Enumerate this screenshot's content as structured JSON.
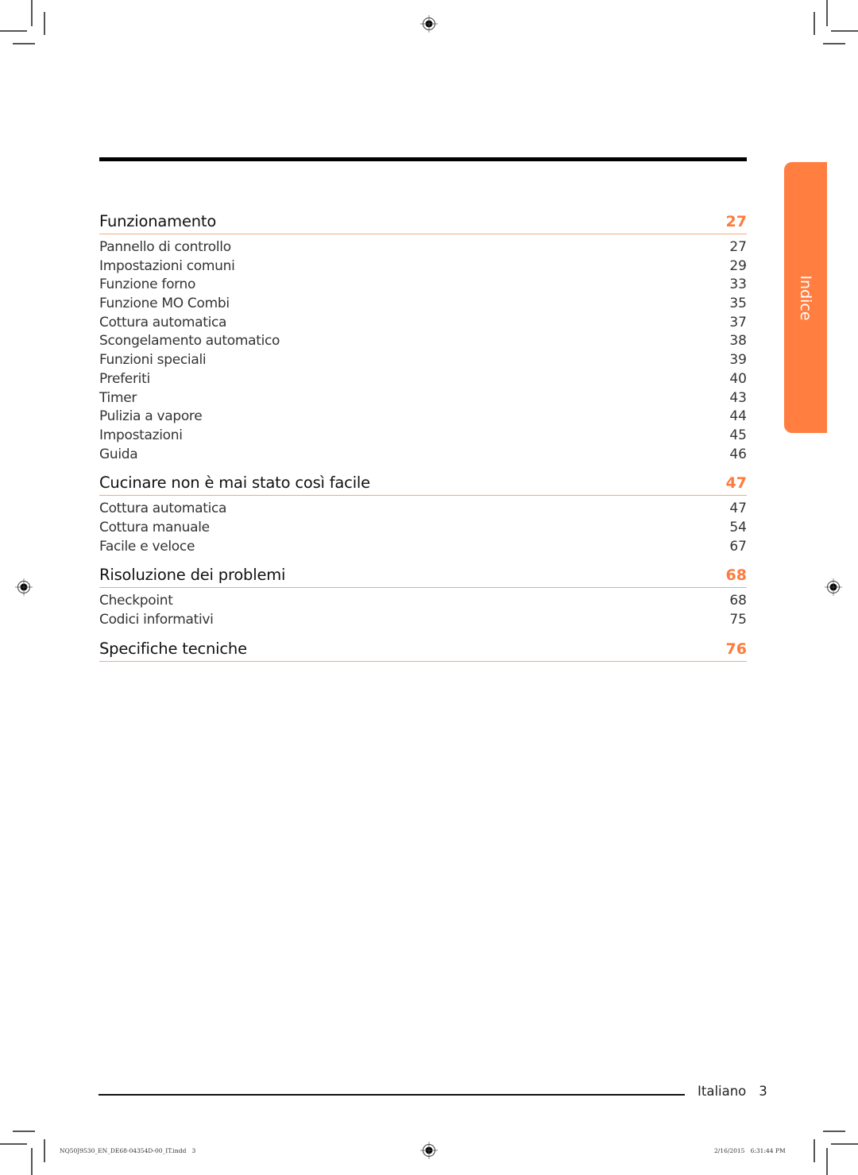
{
  "side_tab": {
    "label": "Indice",
    "color": "#ff7e40"
  },
  "accent_color": "#ff7a3d",
  "toc": [
    {
      "title": "Funzionamento",
      "page": "27",
      "items": [
        {
          "label": "Pannello di controllo",
          "page": "27"
        },
        {
          "label": "Impostazioni comuni",
          "page": "29"
        },
        {
          "label": "Funzione forno",
          "page": "33"
        },
        {
          "label": "Funzione MO Combi",
          "page": "35"
        },
        {
          "label": "Cottura automatica",
          "page": "37"
        },
        {
          "label": "Scongelamento automatico",
          "page": "38"
        },
        {
          "label": "Funzioni speciali",
          "page": "39"
        },
        {
          "label": "Preferiti",
          "page": "40"
        },
        {
          "label": "Timer",
          "page": "43"
        },
        {
          "label": "Pulizia a vapore",
          "page": "44"
        },
        {
          "label": "Impostazioni",
          "page": "45"
        },
        {
          "label": "Guida",
          "page": "46"
        }
      ]
    },
    {
      "title": "Cucinare non è mai stato così facile",
      "page": "47",
      "items": [
        {
          "label": "Cottura automatica",
          "page": "47"
        },
        {
          "label": "Cottura manuale",
          "page": "54"
        },
        {
          "label": "Facile e veloce",
          "page": "67"
        }
      ]
    },
    {
      "title": "Risoluzione dei problemi",
      "page": "68",
      "items": [
        {
          "label": "Checkpoint",
          "page": "68"
        },
        {
          "label": "Codici informativi",
          "page": "75"
        }
      ]
    },
    {
      "title": "Specifiche tecniche",
      "page": "76",
      "items": []
    }
  ],
  "footer": {
    "language": "Italiano",
    "page_number": "3"
  },
  "slug": {
    "file": "NQ50J9530_EN_DE68-04354D-00_IT.indd   3",
    "timestamp": "2/16/2015   6:31:44 PM"
  }
}
